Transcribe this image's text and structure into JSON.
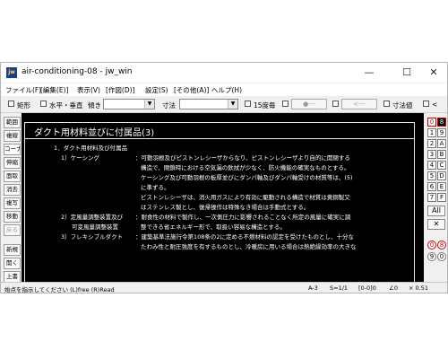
{
  "window": {
    "app_icon": "jw",
    "title": "air-conditioning-08 - jw_win",
    "controls": {
      "minimize": "—",
      "maximize": "☐",
      "close": "✕"
    }
  },
  "menu": [
    "ファイル(F)",
    "[編集(E)]",
    "表示(V)",
    "[作図(D)]",
    "設定(S)",
    "[その他(A)]",
    "ヘルプ(H)"
  ],
  "toolbar": {
    "rect_label": "矩形",
    "hv_label": "水平・垂直",
    "tilt_label": "傾き",
    "size_label": "寸法",
    "deg15_label": "15度毎",
    "btn_circle": "●---",
    "btn_arrow": "<---",
    "dim_value_label": "寸法値",
    "lt_label": "<"
  },
  "left_tools": [
    "範囲",
    "複線",
    "コーナー",
    "伸縮",
    "面取",
    "消去",
    "複写",
    "移動",
    "戻る",
    "新規",
    "開く",
    "上書"
  ],
  "drawing": {
    "heading": "ダクト用材料並びに付属品(3)",
    "lines": [
      "1．ダクト用材料及び付属品",
      "1）ケーシング",
      "：可動羽根及びピストンレシーザからなり、ピストンレシーザより自的に開閉する",
      "構造で、閉鎖時における空気漏の欽拭が少なく、防火機能の確実なものとする。",
      "ケーシング及び可動羽根の板厚並びにダンパ軸及びダンパ軸受けの材質等は、(5)",
      "に準ずる。",
      "ピストンレシーザは、消火用ガスにより有効に駆動される構造で材質は黄銅製又",
      "はステンレス製とし、復帰操作は特殊なき場合は手動式とする。",
      "2）定風量調整装置及び",
      "：耐食性の材料で製作し、一次側圧力に影響されることなく所定の風量に確実に調",
      "可変風量調整装置",
      "整できる省エネルギー形で、取扱い容易な構造とする。",
      "3）フレキシブルダクト",
      "：建築基準法施行令第108条の2に定める不燃材料の認定を受けたものとし、十分な",
      "たわみ性と耐圧強度を有するものとし、冷暖房に用いる場合は熱絶縁効率の大きな"
    ]
  },
  "right_tools": {
    "left_col": [
      "0",
      "1",
      "2",
      "3",
      "4",
      "5",
      "6",
      "7",
      "0",
      "9"
    ],
    "right_col": [
      "8",
      "9",
      "A",
      "B",
      "C",
      "D",
      "E",
      "F",
      "8",
      "0"
    ],
    "all": "All",
    "x_btn": "✕"
  },
  "status": {
    "hint": "始点を指示してください (L)free (R)Read",
    "paper": "A-3",
    "scale": "S=1/1",
    "layer": "[0-0]0",
    "angle": "∠0",
    "zoom": "× 0.51"
  }
}
